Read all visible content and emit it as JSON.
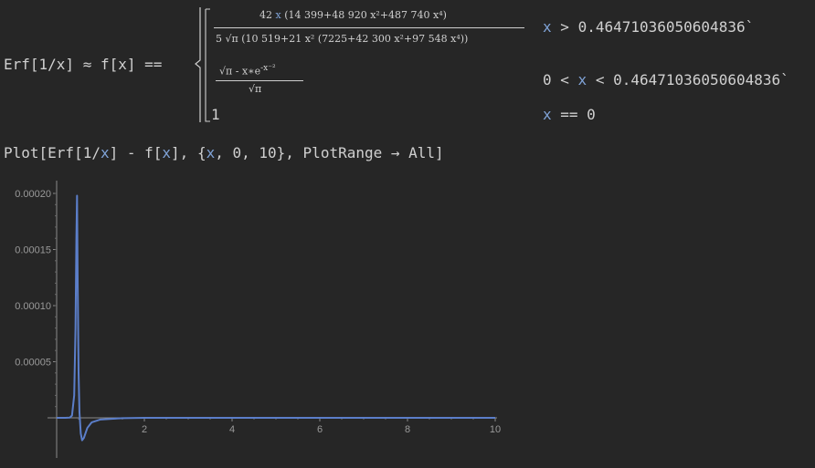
{
  "input1": {
    "lhs": "Erf[1/x] ≈ f[x] ==",
    "case1_numerator_pre": "42",
    "case1_numerator_var": "x",
    "case1_numerator_poly": "(14 399+48 920 x²+487 740 x⁴)",
    "case1_denominator": "5 √π (10 519+21 x² (7225+42 300 x²+97 548 x⁴))",
    "case1_condition_var": "x",
    "case1_condition_op": ">",
    "case1_condition_val": "0.46471036050604836`",
    "case2_numerator": "√π - x∗e",
    "case2_exponent": "-x⁻²",
    "case2_denominator": "√π",
    "case2_condition_lo": "0 <",
    "case2_condition_var": "x",
    "case2_condition_hi": "< 0.46471036050604836`",
    "case3_value": "1",
    "case3_condition_var": "x",
    "case3_condition_rest": " == 0"
  },
  "input2": {
    "p1": "Plot[Erf[1/",
    "v1": "x",
    "p2": "] - f[",
    "v2": "x",
    "p3": "], {",
    "v3": "x",
    "p4": ", 0, 10}, PlotRange → All]"
  },
  "chart_data": {
    "type": "line",
    "title": "",
    "xlabel": "",
    "ylabel": "",
    "xlim": [
      0,
      10
    ],
    "ylim": [
      -2e-05,
      0.00021
    ],
    "x_ticks": [
      "2",
      "4",
      "6",
      "8",
      "10"
    ],
    "y_ticks": [
      "0.00005",
      "0.00010",
      "0.00015",
      "0.00020"
    ],
    "series": [
      {
        "color": "#5b7ec9",
        "x": [
          0,
          0.2,
          0.3,
          0.35,
          0.4,
          0.43,
          0.45,
          0.465,
          0.48,
          0.5,
          0.52,
          0.55,
          0.58,
          0.62,
          0.7,
          0.8,
          1.0,
          1.5,
          2,
          4,
          6,
          8,
          10
        ],
        "y": [
          0,
          0,
          2e-07,
          2e-06,
          2e-05,
          8e-05,
          0.00016,
          0.000198,
          0.00012,
          4e-05,
          5e-06,
          -1.4e-05,
          -2e-05,
          -1.8e-05,
          -9e-06,
          -4e-06,
          -1.5e-06,
          -3e-07,
          0,
          0,
          0,
          0,
          0
        ]
      }
    ]
  }
}
